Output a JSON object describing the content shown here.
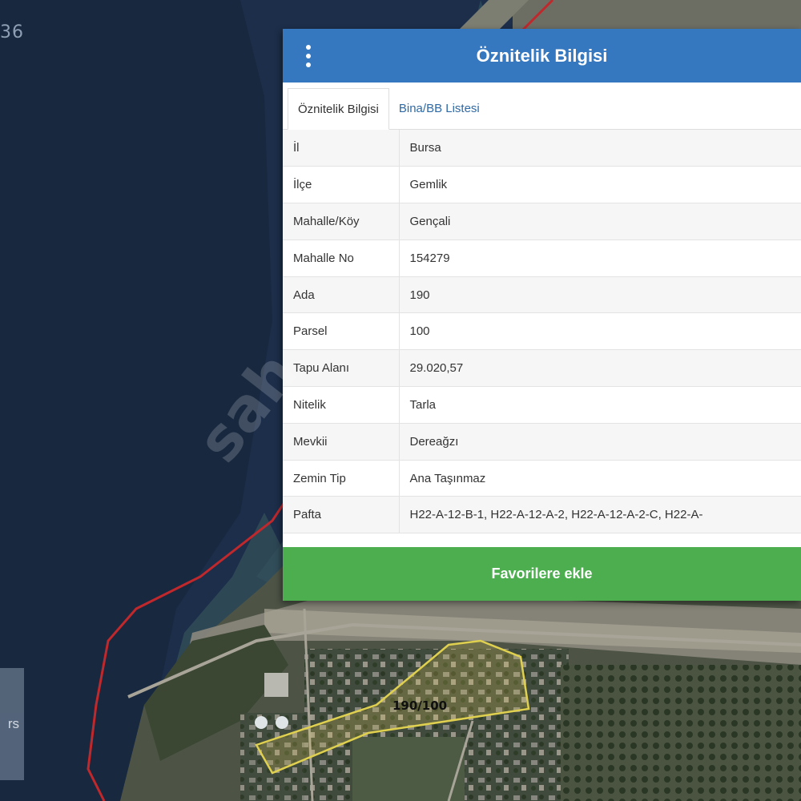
{
  "map": {
    "coord_fragment": "36",
    "side_button_label": "rs",
    "parcel_label": "190/100",
    "watermark": "sah"
  },
  "panel": {
    "title": "Öznitelik Bilgisi",
    "menu_icon": "kebab-menu-icon",
    "tabs": [
      {
        "label": "Öznitelik Bilgisi",
        "active": true
      },
      {
        "label": "Bina/BB Listesi",
        "active": false
      }
    ],
    "rows": [
      {
        "key": "İl",
        "value": "Bursa"
      },
      {
        "key": "İlçe",
        "value": "Gemlik"
      },
      {
        "key": "Mahalle/Köy",
        "value": "Gençali"
      },
      {
        "key": "Mahalle No",
        "value": "154279"
      },
      {
        "key": "Ada",
        "value": "190"
      },
      {
        "key": "Parsel",
        "value": "100"
      },
      {
        "key": "Tapu Alanı",
        "value": "29.020,57"
      },
      {
        "key": "Nitelik",
        "value": "Tarla"
      },
      {
        "key": "Mevkii",
        "value": "Dereağzı"
      },
      {
        "key": "Zemin Tip",
        "value": "Ana Taşınmaz"
      },
      {
        "key": "Pafta",
        "value": "H22-A-12-B-1, H22-A-12-A-2, H22-A-12-A-2-C, H22-A-"
      }
    ],
    "favorite_button_label": "Favorilere ekle"
  },
  "colors": {
    "header": "#3578c0",
    "favorite_button": "#4cae4f",
    "tab_link": "#2e6aa8",
    "boundary_line": "#c0282c",
    "parcel_outline": "#e0d050"
  }
}
